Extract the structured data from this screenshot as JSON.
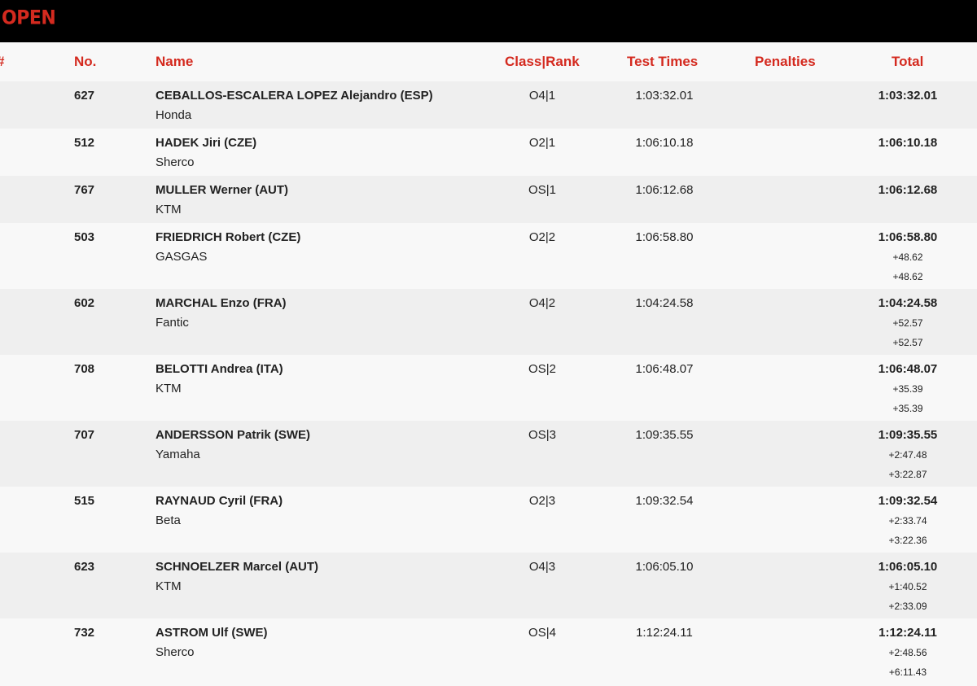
{
  "page": {
    "title": "OPEN",
    "header_hash": "#"
  },
  "columns": {
    "no": "No.",
    "name": "Name",
    "class_rank": "Class|Rank",
    "test_times": "Test Times",
    "penalties": "Penalties",
    "total": "Total"
  },
  "rows": [
    {
      "no": "627",
      "name": "CEBALLOS-ESCALERA LOPEZ Alejandro (ESP)",
      "brand": "Honda",
      "class_rank": "O4|1",
      "test_time": "1:03:32.01",
      "total": "1:03:32.01",
      "gap1": "",
      "gap2": ""
    },
    {
      "no": "512",
      "name": "HADEK Jiri (CZE)",
      "brand": "Sherco",
      "class_rank": "O2|1",
      "test_time": "1:06:10.18",
      "total": "1:06:10.18",
      "gap1": "",
      "gap2": ""
    },
    {
      "no": "767",
      "name": "MULLER Werner (AUT)",
      "brand": "KTM",
      "class_rank": "OS|1",
      "test_time": "1:06:12.68",
      "total": "1:06:12.68",
      "gap1": "",
      "gap2": ""
    },
    {
      "no": "503",
      "name": "FRIEDRICH Robert (CZE)",
      "brand": "GASGAS",
      "class_rank": "O2|2",
      "test_time": "1:06:58.80",
      "total": "1:06:58.80",
      "gap1": "+48.62",
      "gap2": "+48.62"
    },
    {
      "no": "602",
      "name": "MARCHAL Enzo (FRA)",
      "brand": "Fantic",
      "class_rank": "O4|2",
      "test_time": "1:04:24.58",
      "total": "1:04:24.58",
      "gap1": "+52.57",
      "gap2": "+52.57"
    },
    {
      "no": "708",
      "name": "BELOTTI Andrea (ITA)",
      "brand": "KTM",
      "class_rank": "OS|2",
      "test_time": "1:06:48.07",
      "total": "1:06:48.07",
      "gap1": "+35.39",
      "gap2": "+35.39"
    },
    {
      "no": "707",
      "name": "ANDERSSON Patrik (SWE)",
      "brand": "Yamaha",
      "class_rank": "OS|3",
      "test_time": "1:09:35.55",
      "total": "1:09:35.55",
      "gap1": "+2:47.48",
      "gap2": "+3:22.87"
    },
    {
      "no": "515",
      "name": "RAYNAUD Cyril (FRA)",
      "brand": "Beta",
      "class_rank": "O2|3",
      "test_time": "1:09:32.54",
      "total": "1:09:32.54",
      "gap1": "+2:33.74",
      "gap2": "+3:22.36"
    },
    {
      "no": "623",
      "name": "SCHNOELZER Marcel (AUT)",
      "brand": "KTM",
      "class_rank": "O4|3",
      "test_time": "1:06:05.10",
      "total": "1:06:05.10",
      "gap1": "+1:40.52",
      "gap2": "+2:33.09"
    },
    {
      "no": "732",
      "name": "ASTROM Ulf (SWE)",
      "brand": "Sherco",
      "class_rank": "OS|4",
      "test_time": "1:12:24.11",
      "total": "1:12:24.11",
      "gap1": "+2:48.56",
      "gap2": "+6:11.43"
    }
  ]
}
